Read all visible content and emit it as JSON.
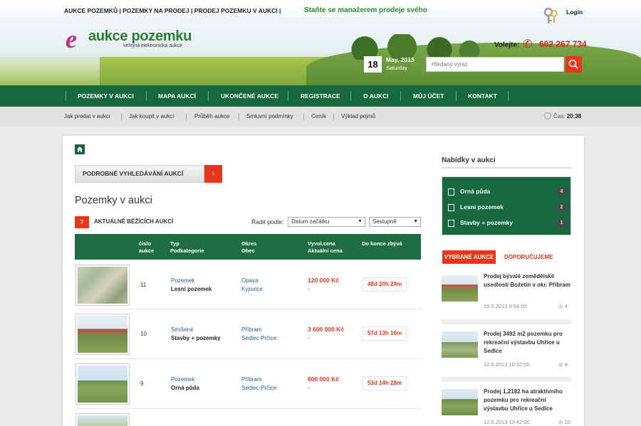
{
  "header": {
    "top_links": "AUKCE POZEMKŮ  |  POZEMKY NA PRODEJ  |  PRODEJ POZEMKU  V AUKCI   |",
    "promo": "Staňte se manažerem prodeje svého",
    "login": "Login",
    "logo_name": "aukce pozemku",
    "logo_sub": "veřejná elektronická aukce",
    "volejte": "Volejte:",
    "phone": "602 267 734",
    "date_day": "18",
    "date_month_year": "May, 2013",
    "date_weekday": "Saturday",
    "search_placeholder": "Hledaný výraz"
  },
  "nav": {
    "items": [
      "POZEMKY V AUKCI",
      "MAPA AUKCÍ",
      "UKONČENÉ AUKCE",
      "REGISTRACE",
      "O AUKCI",
      "MŮJ ÚČET",
      "KONTAKT"
    ]
  },
  "subnav": {
    "items": [
      "Jak prodat v aukci",
      "Jak koupit v aukci",
      "Průběh aukce",
      "Smluvní podmínky",
      "Ceník",
      "Výklad pojmů"
    ],
    "time_label": "Čas:",
    "time_value": "20:38"
  },
  "main": {
    "advanced_search": "PODROBNÉ VYHLEDÁVÁNÍ AUKCÍ",
    "title": "Pozemky v aukci",
    "running_count": "7",
    "running_label": "AKTUÁLNĚ BĚŽÍCÍCH AUKCÍ",
    "sort_label": "Řadit podle:",
    "sort_field": "Datum začátku",
    "sort_order": "Sestupně",
    "columns": [
      {
        "line1": "číslo",
        "line2": "aukce"
      },
      {
        "line1": "Typ",
        "line2": "Podkategorie"
      },
      {
        "line1": "Okres",
        "line2": "Obec"
      },
      {
        "line1": "Vyvol.cena",
        "line2": "Aktuální cena"
      },
      {
        "line1": "Do konce zbývá",
        "line2": ""
      }
    ],
    "rows": [
      {
        "num": "11",
        "type": "Pozemek",
        "subcat": "Lesní pozemek",
        "district": "Opava",
        "town": "Kyjovice",
        "price": "120 000 Kč",
        "current": "-",
        "remaining": "48d 20h 29m"
      },
      {
        "num": "10",
        "type": "Smíšené",
        "subcat": "Stavby + pozemky",
        "district": "Příbram",
        "town": "Sedlec-Prčice",
        "price": "3 600 000 Kč",
        "current": "-",
        "remaining": "57d 13h 16m"
      },
      {
        "num": "9",
        "type": "Pozemek",
        "subcat": "Orná půda",
        "district": "Příbram",
        "town": "Sedlec-Prčice",
        "price": "600 000 Kč",
        "current": "-",
        "remaining": "53d 14h 28m"
      }
    ]
  },
  "sidebar": {
    "offers_title": "Nabídky v aukci",
    "offers": [
      {
        "label": "Orná půda",
        "count": "4"
      },
      {
        "label": "Lesní pozemek",
        "count": "2"
      },
      {
        "label": "Stavby + pozemky",
        "count": "1"
      }
    ],
    "tab_selected": "VYBRANÉ AUKCE",
    "tab_other": "DOPORUČUJEME",
    "news": [
      {
        "text": "Prodej bývalé zemědělské usedlosti Božetín v okr. Příbram",
        "date": "16.5.2013 9:54:00",
        "views": "4"
      },
      {
        "text": "Prodej 3492 m2 pozemku pro rekreační výstavbu Uhřice u Sedlce",
        "date": "12.5.2013 10:32:00",
        "views": "8"
      },
      {
        "text": "Prodej 1,2182 ha atraktivního pozemku pro rekreační výstavbu Uhřice u Sedlce",
        "date": "12.5.2013 10:42:00",
        "views": "10"
      }
    ]
  },
  "colors": {
    "green": "#16683e",
    "accent": "#e8361c"
  }
}
